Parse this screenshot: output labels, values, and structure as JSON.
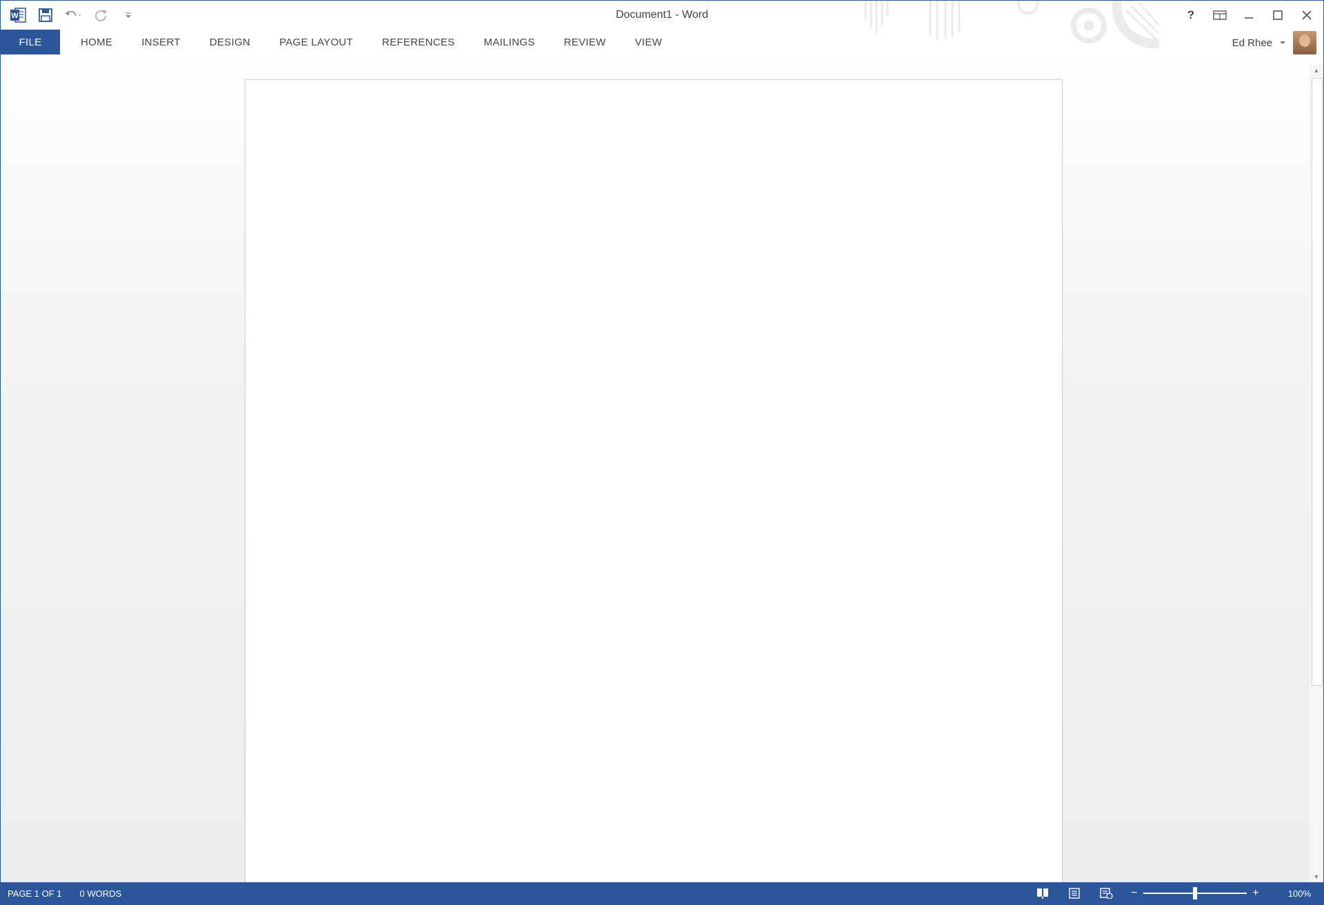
{
  "titlebar": {
    "document_title": "Document1 - Word",
    "help_label": "?"
  },
  "ribbon": {
    "tabs": [
      {
        "label": "FILE"
      },
      {
        "label": "HOME"
      },
      {
        "label": "INSERT"
      },
      {
        "label": "DESIGN"
      },
      {
        "label": "PAGE LAYOUT"
      },
      {
        "label": "REFERENCES"
      },
      {
        "label": "MAILINGS"
      },
      {
        "label": "REVIEW"
      },
      {
        "label": "VIEW"
      }
    ]
  },
  "account": {
    "user_name": "Ed Rhee",
    "dropdown_icon": "chevron-down-icon"
  },
  "quick_access": {
    "icons": [
      "word-logo-icon",
      "save-icon",
      "undo-icon",
      "redo-icon",
      "customize-qat-icon"
    ]
  },
  "statusbar": {
    "page_info": "PAGE 1 OF 1",
    "word_count": "0 WORDS",
    "zoom_level": "100%",
    "zoom_fraction": 0.5
  },
  "colors": {
    "accent": "#2b579a"
  }
}
